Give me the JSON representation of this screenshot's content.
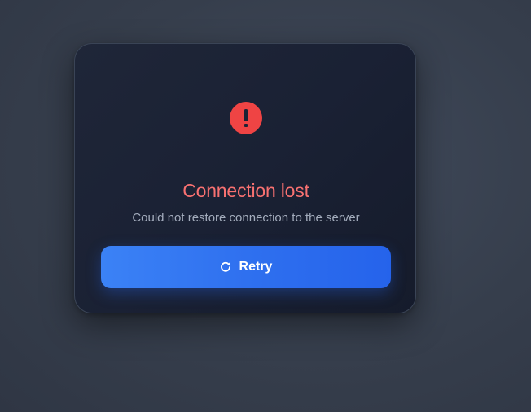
{
  "dialog": {
    "icon": "alert-circle-icon",
    "title": "Connection lost",
    "message": "Could not restore connection to the server",
    "retry_button": {
      "label": "Retry",
      "icon": "refresh-icon"
    }
  },
  "colors": {
    "background": "#3a4250",
    "card": "#1b2235",
    "error": "#ef4444",
    "title": "#f87171",
    "message": "#a4adbd",
    "accent": "#3b82f6"
  }
}
